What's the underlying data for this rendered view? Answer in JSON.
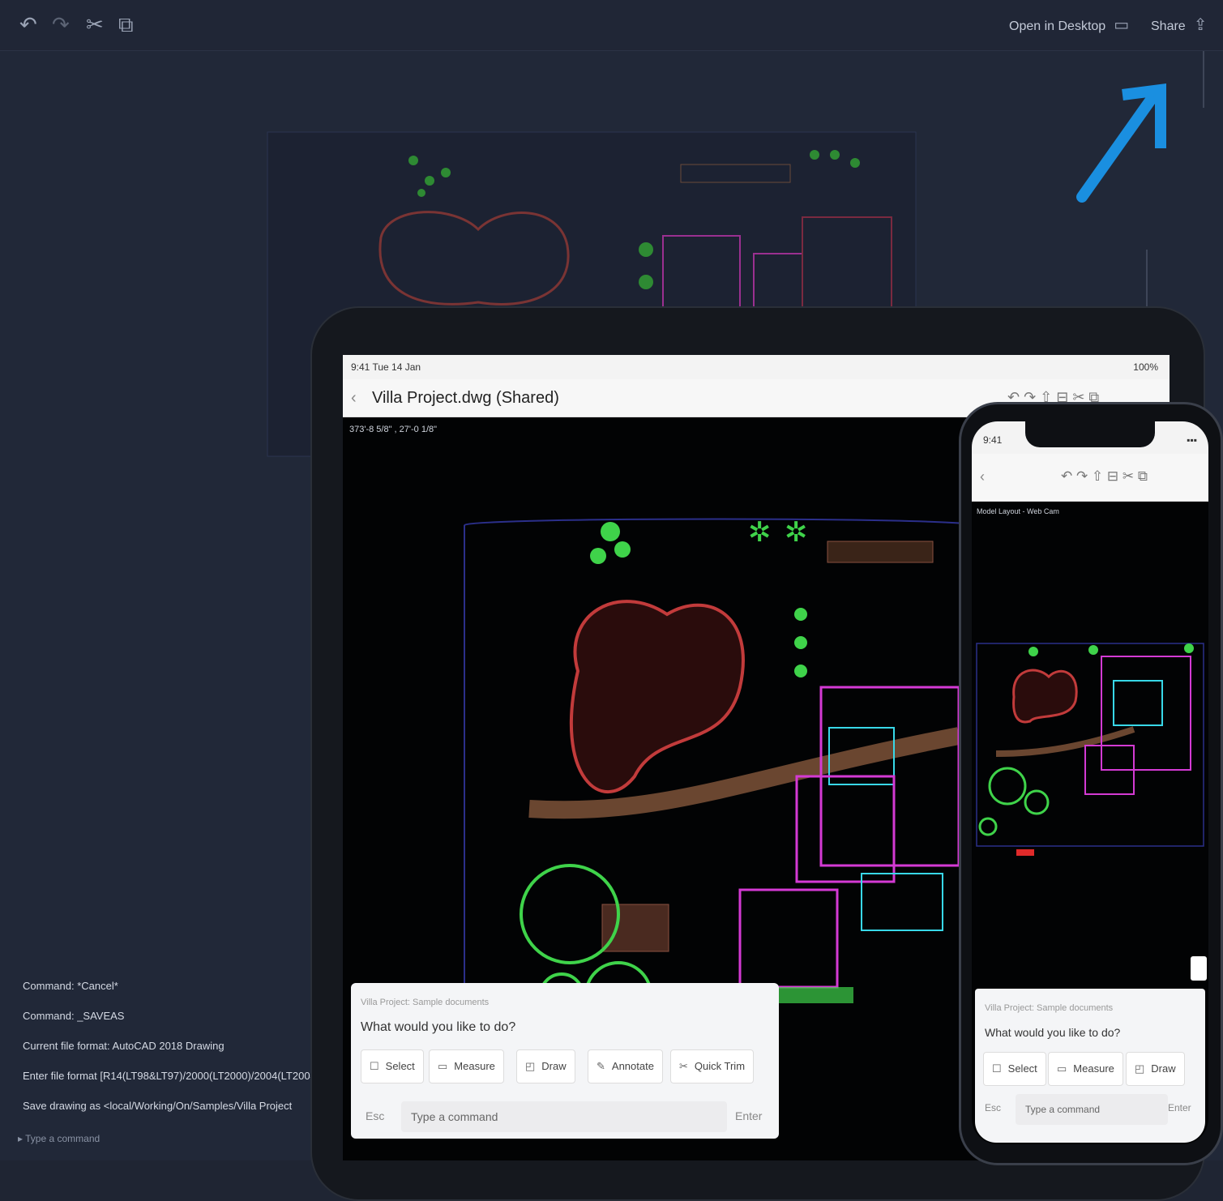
{
  "topbar": {
    "open_desktop_label": "Open in Desktop",
    "share_label": "Share",
    "icons": [
      "undo-icon",
      "redo-icon",
      "cut-icon",
      "copy-icon"
    ]
  },
  "command_log": {
    "lines": [
      "Command: *Cancel*",
      "Command: _SAVEAS",
      "Current file format: AutoCAD 2018 Drawing",
      "Enter file format [R14(LT98&LT97)/2000(LT2000)/2004(LT2004)/20",
      "Save drawing as <local/Working/On/Samples/Villa Project"
    ],
    "prompt": "Type a command"
  },
  "tablet": {
    "status_time": "9:41  Tue 14 Jan",
    "status_battery": "100%",
    "title": "Villa Project.dwg (Shared)",
    "coords": "373'-8 5/8\" , 27'-0 1/8\"",
    "panel": {
      "header": "Villa Project: Sample documents",
      "question": "What would you like to do?",
      "chips": [
        "Select",
        "Measure",
        "Draw",
        "Annotate",
        "Quick Trim"
      ],
      "cmd_label": "Esc",
      "cmd_placeholder": "Type a command",
      "enter_label": "Enter"
    }
  },
  "phone": {
    "status_time": "9:41",
    "coords": "Model Layout - Web Cam",
    "panel": {
      "header": "Villa Project: Sample documents",
      "question": "What would you like to do?",
      "chips": [
        "Select",
        "Measure",
        "Draw"
      ],
      "cmd_label": "Esc",
      "cmd_placeholder": "Type a command",
      "enter_label": "Enter"
    }
  },
  "colors": {
    "arrow": "#1a8fe0",
    "drawing_bg": "#020304",
    "pool": "#c23b3b",
    "walls_magenta": "#d43ad4",
    "cyan": "#38d8e8",
    "green": "#3fd34a"
  }
}
